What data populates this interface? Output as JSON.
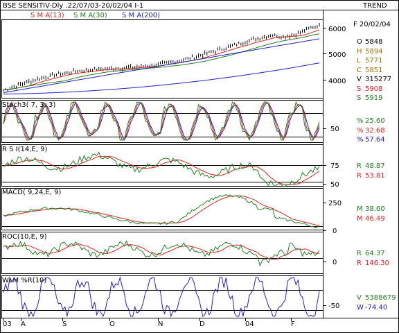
{
  "header": {
    "title": "BSE SENSITIV-Dly .22/07/03-20/02/04  I-1",
    "trend_label": "TREND",
    "sma_labels": [
      {
        "text": "S M A(13)",
        "color": "#e02020"
      },
      {
        "text": "S M A(30)",
        "color": "#208020"
      },
      {
        "text": "S M A(200)",
        "color": "#2020c0"
      }
    ]
  },
  "colors": {
    "price": "#000000",
    "sma13": "#e02020",
    "sma30": "#208020",
    "sma200": "#2020c0",
    "stoch_k": "#208020",
    "stoch_d": "#e02020",
    "stoch_slow": "#2020c0",
    "rsi": "#208020",
    "rsi_signal": "#e02020",
    "macd": "#208020",
    "macd_signal": "#e02020",
    "roc": "#208020",
    "roc_signal": "#e02020",
    "wlm": "#2020c0"
  },
  "price_panel": {
    "date_label": "F 20/02/04",
    "axis_ticks": [
      "6000",
      "5000",
      "4000"
    ],
    "ohlc": [
      {
        "key": "O",
        "value": "5848",
        "color": "#000000"
      },
      {
        "key": "H",
        "value": "5894",
        "color": "#a07000"
      },
      {
        "key": "L",
        "value": "5771",
        "color": "#a07000"
      },
      {
        "key": "C",
        "value": "5851",
        "color": "#a07000"
      },
      {
        "key": "V",
        "value": "315277",
        "color": "#000000"
      },
      {
        "key": "S",
        "value": "5908",
        "color": "#e02020"
      },
      {
        "key": "S",
        "value": "5919",
        "color": "#208020"
      }
    ]
  },
  "stoch_panel": {
    "label": "Stoch3( 7, 3, 3)",
    "axis_ticks": [
      "50"
    ],
    "values": [
      {
        "key": "%",
        "value": "25.60",
        "color": "#208020"
      },
      {
        "key": "%",
        "value": "32.68",
        "color": "#e02020"
      },
      {
        "key": "%",
        "value": "57.64",
        "color": "#2020c0"
      }
    ]
  },
  "rsi_panel": {
    "label": "R S I(14,E, 9)",
    "axis_ticks": [
      "75",
      "50"
    ],
    "values": [
      {
        "key": "R",
        "value": "48.87",
        "color": "#208020"
      },
      {
        "key": "R",
        "value": "53.81",
        "color": "#e02020"
      }
    ]
  },
  "macd_panel": {
    "label": "MACD( 9,24,E, 9)",
    "axis_ticks": [
      "250",
      "0"
    ],
    "values": [
      {
        "key": "M",
        "value": "38.60",
        "color": "#208020"
      },
      {
        "key": "M",
        "value": "46.49",
        "color": "#e02020"
      }
    ]
  },
  "roc_panel": {
    "label": "ROC(10,E, 9)",
    "axis_ticks": [
      "0"
    ],
    "values": [
      {
        "key": "R",
        "value": "64.37",
        "color": "#208020"
      },
      {
        "key": "R",
        "value": "146.30",
        "color": "#e02020"
      }
    ]
  },
  "wlm_panel": {
    "label": "WLM %R(10)",
    "axis_ticks": [
      "-50"
    ],
    "values": [
      {
        "key": "V",
        "value": "5388679",
        "color": "#208020"
      },
      {
        "key": "W",
        "value": "-74.40",
        "color": "#2020c0"
      }
    ]
  },
  "x_axis": {
    "labels": [
      "03",
      "A",
      "S",
      "O",
      "N",
      "D",
      "04",
      "F"
    ]
  }
}
